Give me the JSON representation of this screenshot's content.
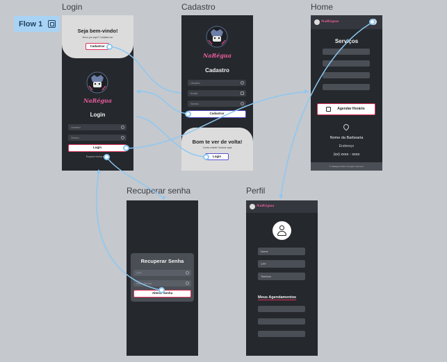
{
  "flow": {
    "label": "Flow 1"
  },
  "frames": {
    "login": "Login",
    "cadastro": "Cadastro",
    "home": "Home",
    "recuperar": "Recuperar senha",
    "perfil": "Perfil"
  },
  "brand": "NaRégua",
  "login": {
    "welcome_title": "Seja bem-vindo!",
    "welcome_sub": "Novo por aqui? Cadastre-se",
    "register_btn": "Cadastrar",
    "title": "Login",
    "user_placeholder": "Usuário",
    "pass_placeholder": "Senha",
    "login_btn": "Login",
    "forgot_link": "Esqueci minha senha"
  },
  "cadastro": {
    "title": "Cadastro",
    "user_placeholder": "Usuário",
    "email_placeholder": "Email",
    "pass_placeholder": "Senha",
    "register_btn": "Cadastrar",
    "back_title": "Bom te ver de volta!",
    "back_sub": "Conta criada? Acesse aqui",
    "login_btn": "Login"
  },
  "home": {
    "title": "Serviços",
    "schedule_btn": "Agendar Horário",
    "shop_name": "Nome  da Barbearia",
    "address": "Endereço",
    "phone": "(xx) xxxx - xxxx",
    "footer": "© NaRégua 2024. All rights reserved."
  },
  "recuperar": {
    "title": "Recuperar Senha",
    "cpf_placeholder": "CPF",
    "newpass_placeholder": "Nova Senha",
    "change_btn": "Alterar Senha"
  },
  "perfil": {
    "nome_label": "Nome",
    "cpf_label": "CPF",
    "telefone_label": "Telefone",
    "section_title": "Meus Agendamentos"
  }
}
